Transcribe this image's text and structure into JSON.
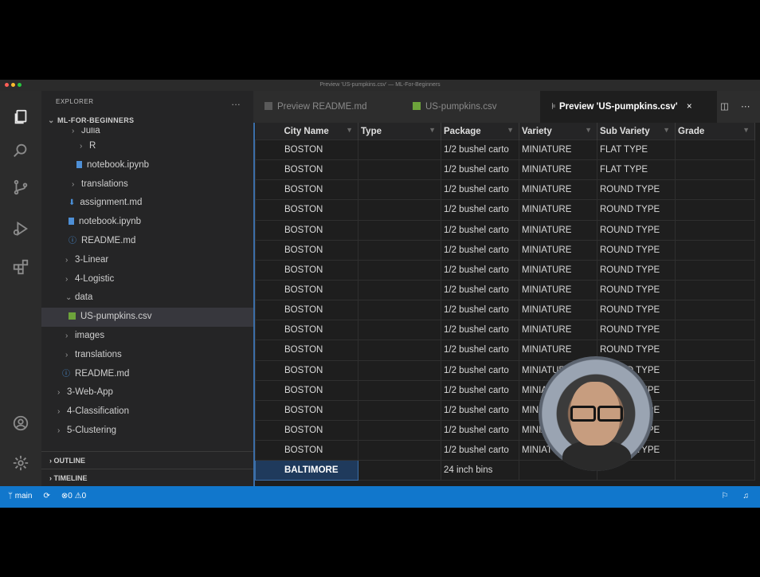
{
  "window": {
    "title": "Preview 'US-pumpkins.csv' — ML-For-Beginners"
  },
  "sidebar": {
    "header": "EXPLORER",
    "more": "...",
    "root": "ML-FOR-BEGINNERS",
    "items": [
      {
        "label": "Julia",
        "kind": "folder"
      },
      {
        "label": "R",
        "kind": "folder"
      },
      {
        "label": "notebook.ipynb",
        "kind": "notebook"
      },
      {
        "label": "translations",
        "kind": "folder"
      },
      {
        "label": "assignment.md",
        "kind": "md"
      },
      {
        "label": "notebook.ipynb",
        "kind": "notebook"
      },
      {
        "label": "README.md",
        "kind": "info"
      },
      {
        "label": "3-Linear",
        "kind": "folder"
      },
      {
        "label": "4-Logistic",
        "kind": "folder"
      },
      {
        "label": "data",
        "kind": "folder-open"
      },
      {
        "label": "US-pumpkins.csv",
        "kind": "csv"
      },
      {
        "label": "images",
        "kind": "folder"
      },
      {
        "label": "translations",
        "kind": "folder"
      },
      {
        "label": "README.md",
        "kind": "info"
      },
      {
        "label": "3-Web-App",
        "kind": "folder"
      },
      {
        "label": "4-Classification",
        "kind": "folder"
      },
      {
        "label": "5-Clustering",
        "kind": "folder"
      }
    ],
    "outline": "OUTLINE",
    "timeline": "TIMELINE"
  },
  "tabs": [
    {
      "label": "Preview README.md"
    },
    {
      "label": "US-pumpkins.csv"
    },
    {
      "label": "Preview 'US-pumpkins.csv'",
      "close": "×"
    }
  ],
  "table": {
    "headers": [
      "City Name",
      "Type",
      "Package",
      "Variety",
      "Sub Variety",
      "Grade"
    ],
    "rows": [
      [
        "BOSTON",
        "",
        "1/2 bushel carto",
        "MINIATURE",
        "FLAT TYPE",
        ""
      ],
      [
        "BOSTON",
        "",
        "1/2 bushel carto",
        "MINIATURE",
        "FLAT TYPE",
        ""
      ],
      [
        "BOSTON",
        "",
        "1/2 bushel carto",
        "MINIATURE",
        "ROUND TYPE",
        ""
      ],
      [
        "BOSTON",
        "",
        "1/2 bushel carto",
        "MINIATURE",
        "ROUND TYPE",
        ""
      ],
      [
        "BOSTON",
        "",
        "1/2 bushel carto",
        "MINIATURE",
        "ROUND TYPE",
        ""
      ],
      [
        "BOSTON",
        "",
        "1/2 bushel carto",
        "MINIATURE",
        "ROUND TYPE",
        ""
      ],
      [
        "BOSTON",
        "",
        "1/2 bushel carto",
        "MINIATURE",
        "ROUND TYPE",
        ""
      ],
      [
        "BOSTON",
        "",
        "1/2 bushel carto",
        "MINIATURE",
        "ROUND TYPE",
        ""
      ],
      [
        "BOSTON",
        "",
        "1/2 bushel carto",
        "MINIATURE",
        "ROUND TYPE",
        ""
      ],
      [
        "BOSTON",
        "",
        "1/2 bushel carto",
        "MINIATURE",
        "ROUND TYPE",
        ""
      ],
      [
        "BOSTON",
        "",
        "1/2 bushel carto",
        "MINIATURE",
        "ROUND TYPE",
        ""
      ],
      [
        "BOSTON",
        "",
        "1/2 bushel carto",
        "MINIATURE",
        "ROUND TYPE",
        ""
      ],
      [
        "BOSTON",
        "",
        "1/2 bushel carto",
        "MINIATURE",
        "ROUND TYPE",
        ""
      ],
      [
        "BOSTON",
        "",
        "1/2 bushel carto",
        "MINIATURE",
        "ROUND TYPE",
        ""
      ],
      [
        "BOSTON",
        "",
        "1/2 bushel carto",
        "MINIATURE",
        "ROUND TYPE",
        ""
      ],
      [
        "BOSTON",
        "",
        "1/2 bushel carto",
        "MINIATURE",
        "ROUND TYPE",
        ""
      ],
      [
        "BALTIMORE",
        "",
        "24 inch bins",
        "",
        "",
        ""
      ]
    ]
  },
  "statusbar": {
    "branch": "main",
    "errors": "0",
    "warnings": "0"
  },
  "colors": {
    "statusbar": "#1177cc",
    "activityBar": "#2c2c2c",
    "sidebar": "#252526",
    "editor": "#1e1e1e"
  }
}
